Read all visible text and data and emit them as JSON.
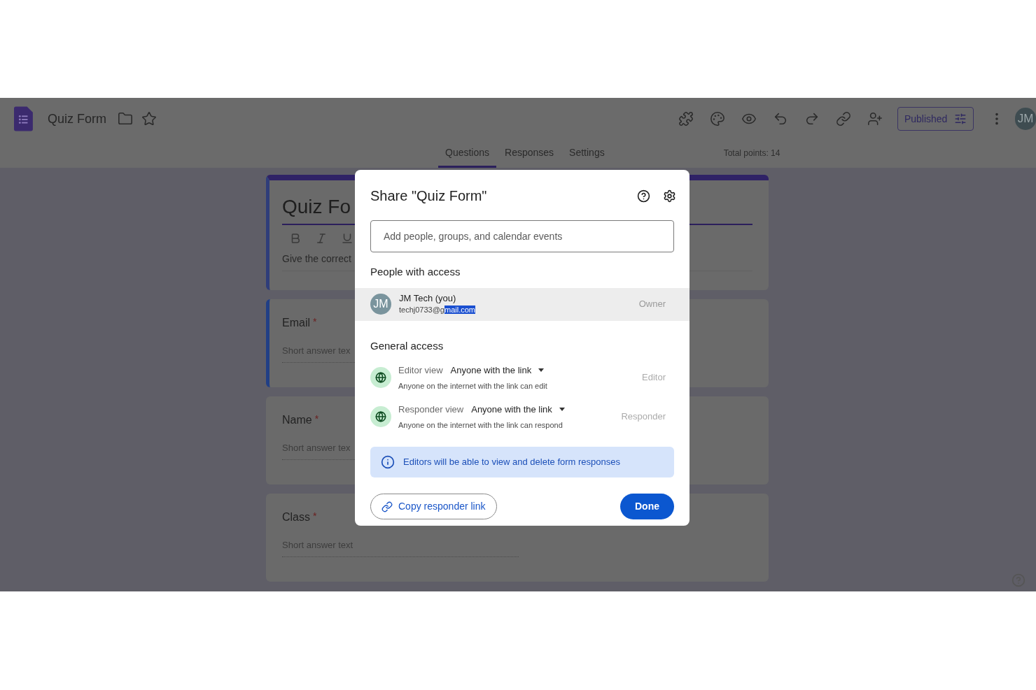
{
  "app_bar": {
    "title": "Quiz Form",
    "publish_button": "Published",
    "avatar": "JM"
  },
  "tabs": [
    {
      "label": "Questions",
      "selected": true
    },
    {
      "label": "Responses",
      "selected": false
    },
    {
      "label": "Settings",
      "selected": false
    }
  ],
  "total_points": "Total points: 14",
  "form": {
    "title": "Quiz Fo",
    "description": "Give the correct",
    "questions": [
      {
        "label": "Email",
        "marker": "*",
        "placeholder": "Short answer tex",
        "active": true
      },
      {
        "label": "Name",
        "marker": "*",
        "placeholder": "Short answer tex",
        "active": false
      },
      {
        "label": "Class",
        "marker": "*",
        "placeholder": "Short answer text",
        "active": false
      }
    ]
  },
  "share_dialog": {
    "title": "Share \"Quiz Form\"",
    "search": {
      "placeholder": "Add people, groups, and calendar events"
    },
    "people_heading": "People with access",
    "people": [
      {
        "avatar": "JM",
        "name": "JM Tech (you)",
        "email_before_selection": "techj0733@g",
        "email_selection": "mail.com",
        "role": "Owner"
      }
    ],
    "general_heading": "General access",
    "access": [
      {
        "label": "Editor view",
        "value": "Anyone with the link",
        "description": "Anyone on the internet with the link can edit",
        "role": "Editor"
      },
      {
        "label": "Responder view",
        "value": "Anyone with the link",
        "description": "Anyone on the internet with the link can respond",
        "role": "Responder"
      }
    ],
    "notice": "Editors will be able to view and delete form responses",
    "copy_button": "Copy responder link",
    "done_button": "Done"
  }
}
